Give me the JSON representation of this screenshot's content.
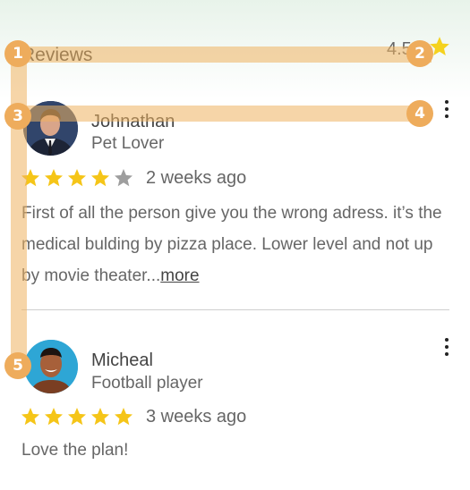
{
  "header": {
    "title": "Reviews",
    "rating": "4.5",
    "rating_icon": "star-icon"
  },
  "reviews": [
    {
      "name": "Johnathan",
      "role": "Pet Lover",
      "stars": 4,
      "stars_max": 5,
      "date": "2 weeks ago",
      "text": "First of all the person give you the wrong adress. it’s the medical bulding by pizza place. Lower level and not up by movie theater...",
      "more_label": "more"
    },
    {
      "name": "Micheal",
      "role": "Football player",
      "stars": 5,
      "stars_max": 5,
      "date": "3 weeks ago",
      "text": "Love the plan!"
    }
  ],
  "annotations": {
    "labels": [
      "1",
      "2",
      "3",
      "4",
      "5"
    ]
  },
  "colors": {
    "star_filled": "#f5c518",
    "star_empty": "#9e9e9e",
    "annotation": "#eeac5c"
  }
}
